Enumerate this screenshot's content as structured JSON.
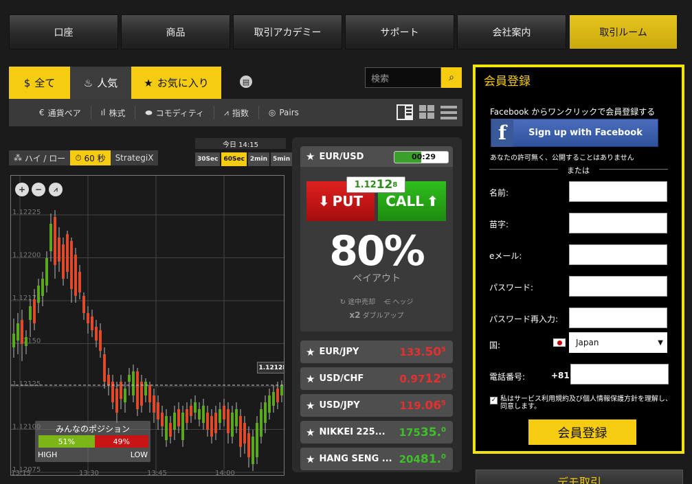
{
  "topnav": [
    "口座",
    "商品",
    "取引アカデミー",
    "サポート",
    "会社案内",
    "取引ルーム"
  ],
  "filters": {
    "all": "全て",
    "popular": "人気",
    "favorites": "お気に入り"
  },
  "search": {
    "placeholder": "検索"
  },
  "subnav": [
    "通貨ペア",
    "株式",
    "コモディティ",
    "指数",
    "Pairs"
  ],
  "modes": [
    "ハイ / ロー",
    "60 秒",
    "StrategiX"
  ],
  "today_label": "今日 14:15",
  "times": [
    "30Sec",
    "60Sec",
    "2min",
    "5min"
  ],
  "chart_data": {
    "type": "candlestick",
    "y_ticks": [
      "1.12225",
      "1.12200",
      "1.12175",
      "1.12150",
      "1.12125",
      "1.12100",
      "1.12075"
    ],
    "x_ticks": [
      "13:15",
      "13:30",
      "13:45",
      "14:00"
    ],
    "current_price": "1.12128"
  },
  "sentiment": {
    "title": "みんなのポジション",
    "high_pct": "51%",
    "low_pct": "49%",
    "high_label": "HIGH",
    "low_label": "LOW",
    "high_value": 51
  },
  "main_asset": {
    "name": "EUR/USD",
    "timer": "00:29",
    "timer_fill": 0.5,
    "quote_main": "1.12",
    "quote_big": "12",
    "quote_sup": "8",
    "put": "PUT",
    "call": "CALL",
    "payout_pct": "80%",
    "payout_label": "ペイアウト",
    "opt_close": "途中売却",
    "opt_hedge": "ヘッジ",
    "opt_double_prefix": "x2",
    "opt_double": "ダブルアップ"
  },
  "assets": [
    {
      "name": "EUR/JPY",
      "p1": "133.",
      "p2": "50",
      "sup": "5",
      "color": "red"
    },
    {
      "name": "USD/CHF",
      "p1": "0.97",
      "p2": "12",
      "sup": "0",
      "color": "red"
    },
    {
      "name": "USD/JPY",
      "p1": "119.",
      "p2": "06",
      "sup": "5",
      "color": "red"
    },
    {
      "name": "NIKKEI 225...",
      "p1": "175",
      "p2": "35.",
      "sup": "0",
      "color": "green"
    },
    {
      "name": "HANG SENG ...",
      "p1": "204",
      "p2": "81.",
      "sup": "0",
      "color": "green"
    }
  ],
  "register": {
    "title": "会員登録",
    "fb_text": "Facebook からワンクリックで会員登録する",
    "fb_button": "Sign up with Facebook",
    "fb_note": "あなたの許可無く、公開することはありません",
    "or": "または",
    "name": "名前:",
    "surname": "苗字:",
    "email": "eメール:",
    "password": "パスワード:",
    "password2": "パスワード再入力:",
    "country": "国:",
    "country_value": "Japan",
    "phone": "電話番号:",
    "phone_code": "+81",
    "terms": "私はサービス利用規約及び個人情報保護方針を理解し、同意します。",
    "submit": "会員登録"
  },
  "demo": "デモ取引"
}
